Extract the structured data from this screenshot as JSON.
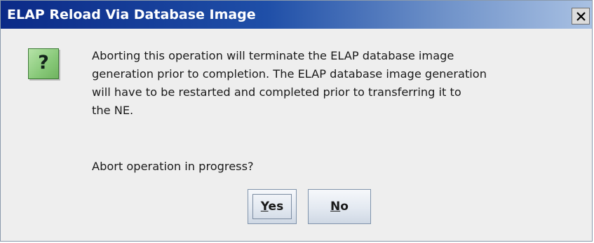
{
  "window": {
    "title": "ELAP Reload Via Database Image",
    "close_icon": "close-x-icon"
  },
  "dialog": {
    "icon": "question-icon",
    "icon_glyph": "?",
    "message_lines": [
      "Aborting this operation will terminate the ELAP database image",
      "generation prior to completion. The ELAP database image generation",
      "will have to be restarted and completed prior to transferring it to",
      "the NE."
    ],
    "question": "Abort operation in progress?"
  },
  "buttons": {
    "yes": {
      "mnemonic": "Y",
      "rest": "es"
    },
    "no": {
      "mnemonic": "N",
      "rest": "o"
    }
  },
  "colors": {
    "titlebar_start": "#0b2a87",
    "titlebar_end": "#a9c1e3",
    "background": "#eeeeee",
    "icon_green": "#87c878"
  }
}
